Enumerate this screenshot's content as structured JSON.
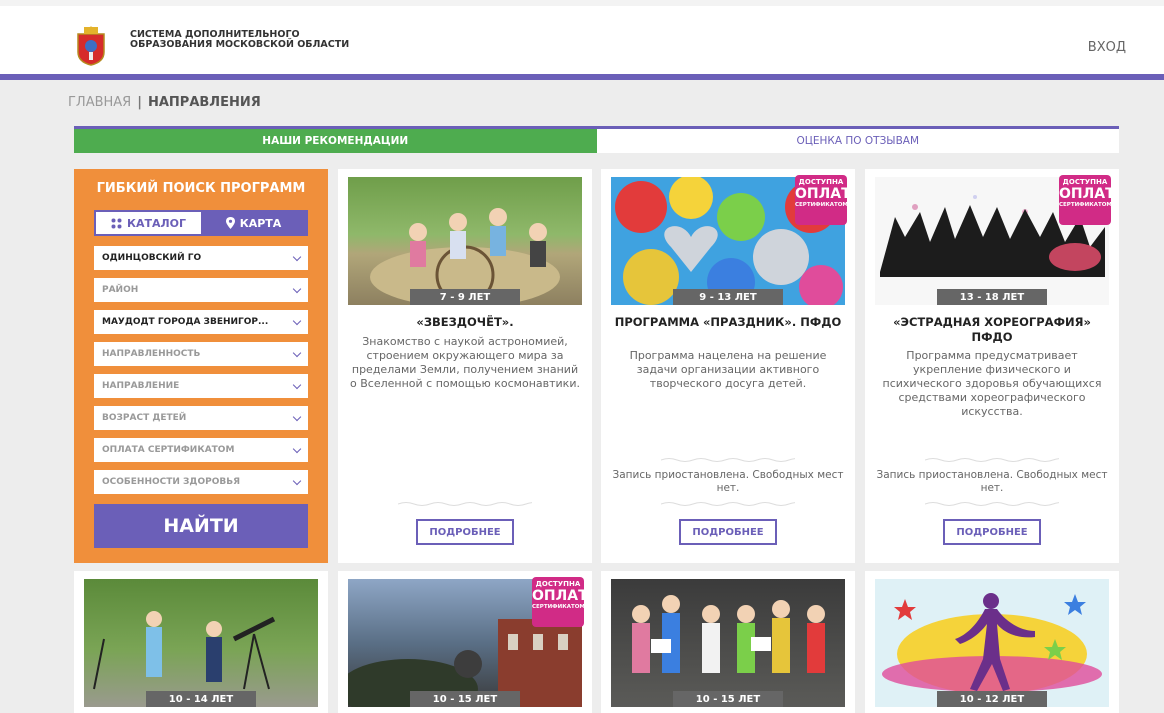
{
  "header": {
    "logo_text": "СИСТЕМА ДОПОЛНИТЕЛЬНОГО ОБРАЗОВАНИЯ МОСКОВСКОЙ ОБЛАСТИ",
    "login": "ВХОД"
  },
  "breadcrumb": {
    "home": "ГЛАВНАЯ",
    "separator": "|",
    "current": "НАПРАВЛЕНИЯ"
  },
  "tabs": [
    "НАШИ РЕКОМЕНДАЦИИ",
    "ОЦЕНКА ПО ОТЗЫВАМ"
  ],
  "filter": {
    "title": "ГИБКИЙ ПОИСК ПРОГРАММ",
    "modes": [
      "КАТАЛОГ",
      "КАРТА"
    ],
    "selects": [
      {
        "value": "ОДИНЦОВСКИЙ ГО",
        "placeholder": false
      },
      {
        "value": "РАЙОН",
        "placeholder": true
      },
      {
        "value": "МАУДОДТ ГОРОДА ЗВЕНИГОР...",
        "placeholder": false
      },
      {
        "value": "НАПРАВЛЕННОСТЬ",
        "placeholder": true
      },
      {
        "value": "НАПРАВЛЕНИЕ",
        "placeholder": true
      },
      {
        "value": "ВОЗРАСТ ДЕТЕЙ",
        "placeholder": true
      },
      {
        "value": "ОПЛАТА СЕРТИФИКАТОМ",
        "placeholder": true
      },
      {
        "value": "ОСОБЕННОСТИ ЗДОРОВЬЯ",
        "placeholder": true
      }
    ],
    "find_label": "НАЙТИ"
  },
  "badge": {
    "line1": "ДОСТУПНА",
    "line2": "ОПЛАТА",
    "line3": "СЕРТИФИКАТОМ"
  },
  "more_label": "ПОДРОБНЕЕ",
  "cards": [
    {
      "age": "7 - 9 ЛЕТ",
      "title": "«ЗВЕЗДОЧЁТ».",
      "desc": "Знакомство с наукой астрономией, строением окружающего мира за пределами Земли, получением знаний о Вселенной с помощью космонавтики.",
      "status": ""
    },
    {
      "age": "9 - 13 ЛЕТ",
      "title": "ПРОГРАММА «ПРАЗДНИК». ПФДО",
      "desc": "Программа нацелена на решение задачи организации активного творческого досуга детей.",
      "status": "Запись приостановлена. Свободных мест нет."
    },
    {
      "age": "13 - 18 ЛЕТ",
      "title": "«ЭСТРАДНАЯ ХОРЕОГРАФИЯ» ПФДО",
      "desc": "Программа предусматривает укрепление физического и психического здоровья обучающихся средствами хореографического искусства.",
      "status": "Запись приостановлена. Свободных мест нет."
    },
    {
      "age": "10 - 14 ЛЕТ"
    },
    {
      "age": "10 - 15 ЛЕТ"
    },
    {
      "age": "10 - 15 ЛЕТ"
    },
    {
      "age": "10 - 12 ЛЕТ"
    }
  ],
  "colors": {
    "purple": "#6b5fb8",
    "green": "#4eac4f",
    "orange": "#f08f3b",
    "badge": "#d12b86"
  }
}
